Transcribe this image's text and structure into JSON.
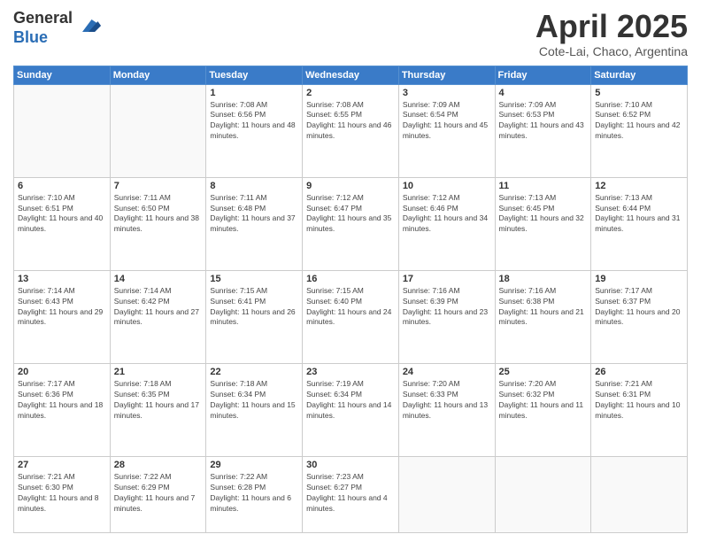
{
  "header": {
    "logo_general": "General",
    "logo_blue": "Blue",
    "month": "April 2025",
    "location": "Cote-Lai, Chaco, Argentina"
  },
  "weekdays": [
    "Sunday",
    "Monday",
    "Tuesday",
    "Wednesday",
    "Thursday",
    "Friday",
    "Saturday"
  ],
  "weeks": [
    [
      {
        "day": "",
        "info": ""
      },
      {
        "day": "",
        "info": ""
      },
      {
        "day": "1",
        "info": "Sunrise: 7:08 AM\nSunset: 6:56 PM\nDaylight: 11 hours and 48 minutes."
      },
      {
        "day": "2",
        "info": "Sunrise: 7:08 AM\nSunset: 6:55 PM\nDaylight: 11 hours and 46 minutes."
      },
      {
        "day": "3",
        "info": "Sunrise: 7:09 AM\nSunset: 6:54 PM\nDaylight: 11 hours and 45 minutes."
      },
      {
        "day": "4",
        "info": "Sunrise: 7:09 AM\nSunset: 6:53 PM\nDaylight: 11 hours and 43 minutes."
      },
      {
        "day": "5",
        "info": "Sunrise: 7:10 AM\nSunset: 6:52 PM\nDaylight: 11 hours and 42 minutes."
      }
    ],
    [
      {
        "day": "6",
        "info": "Sunrise: 7:10 AM\nSunset: 6:51 PM\nDaylight: 11 hours and 40 minutes."
      },
      {
        "day": "7",
        "info": "Sunrise: 7:11 AM\nSunset: 6:50 PM\nDaylight: 11 hours and 38 minutes."
      },
      {
        "day": "8",
        "info": "Sunrise: 7:11 AM\nSunset: 6:48 PM\nDaylight: 11 hours and 37 minutes."
      },
      {
        "day": "9",
        "info": "Sunrise: 7:12 AM\nSunset: 6:47 PM\nDaylight: 11 hours and 35 minutes."
      },
      {
        "day": "10",
        "info": "Sunrise: 7:12 AM\nSunset: 6:46 PM\nDaylight: 11 hours and 34 minutes."
      },
      {
        "day": "11",
        "info": "Sunrise: 7:13 AM\nSunset: 6:45 PM\nDaylight: 11 hours and 32 minutes."
      },
      {
        "day": "12",
        "info": "Sunrise: 7:13 AM\nSunset: 6:44 PM\nDaylight: 11 hours and 31 minutes."
      }
    ],
    [
      {
        "day": "13",
        "info": "Sunrise: 7:14 AM\nSunset: 6:43 PM\nDaylight: 11 hours and 29 minutes."
      },
      {
        "day": "14",
        "info": "Sunrise: 7:14 AM\nSunset: 6:42 PM\nDaylight: 11 hours and 27 minutes."
      },
      {
        "day": "15",
        "info": "Sunrise: 7:15 AM\nSunset: 6:41 PM\nDaylight: 11 hours and 26 minutes."
      },
      {
        "day": "16",
        "info": "Sunrise: 7:15 AM\nSunset: 6:40 PM\nDaylight: 11 hours and 24 minutes."
      },
      {
        "day": "17",
        "info": "Sunrise: 7:16 AM\nSunset: 6:39 PM\nDaylight: 11 hours and 23 minutes."
      },
      {
        "day": "18",
        "info": "Sunrise: 7:16 AM\nSunset: 6:38 PM\nDaylight: 11 hours and 21 minutes."
      },
      {
        "day": "19",
        "info": "Sunrise: 7:17 AM\nSunset: 6:37 PM\nDaylight: 11 hours and 20 minutes."
      }
    ],
    [
      {
        "day": "20",
        "info": "Sunrise: 7:17 AM\nSunset: 6:36 PM\nDaylight: 11 hours and 18 minutes."
      },
      {
        "day": "21",
        "info": "Sunrise: 7:18 AM\nSunset: 6:35 PM\nDaylight: 11 hours and 17 minutes."
      },
      {
        "day": "22",
        "info": "Sunrise: 7:18 AM\nSunset: 6:34 PM\nDaylight: 11 hours and 15 minutes."
      },
      {
        "day": "23",
        "info": "Sunrise: 7:19 AM\nSunset: 6:34 PM\nDaylight: 11 hours and 14 minutes."
      },
      {
        "day": "24",
        "info": "Sunrise: 7:20 AM\nSunset: 6:33 PM\nDaylight: 11 hours and 13 minutes."
      },
      {
        "day": "25",
        "info": "Sunrise: 7:20 AM\nSunset: 6:32 PM\nDaylight: 11 hours and 11 minutes."
      },
      {
        "day": "26",
        "info": "Sunrise: 7:21 AM\nSunset: 6:31 PM\nDaylight: 11 hours and 10 minutes."
      }
    ],
    [
      {
        "day": "27",
        "info": "Sunrise: 7:21 AM\nSunset: 6:30 PM\nDaylight: 11 hours and 8 minutes."
      },
      {
        "day": "28",
        "info": "Sunrise: 7:22 AM\nSunset: 6:29 PM\nDaylight: 11 hours and 7 minutes."
      },
      {
        "day": "29",
        "info": "Sunrise: 7:22 AM\nSunset: 6:28 PM\nDaylight: 11 hours and 6 minutes."
      },
      {
        "day": "30",
        "info": "Sunrise: 7:23 AM\nSunset: 6:27 PM\nDaylight: 11 hours and 4 minutes."
      },
      {
        "day": "",
        "info": ""
      },
      {
        "day": "",
        "info": ""
      },
      {
        "day": "",
        "info": ""
      }
    ]
  ]
}
